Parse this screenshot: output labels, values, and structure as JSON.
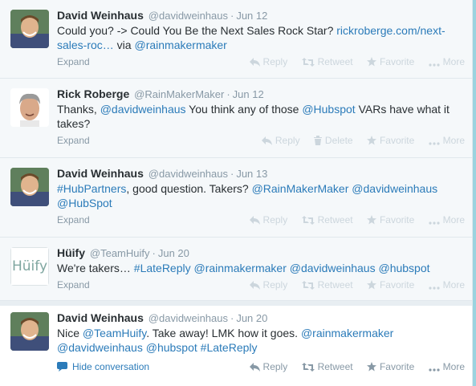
{
  "actions": {
    "reply": "Reply",
    "retweet": "Retweet",
    "delete": "Delete",
    "favorite": "Favorite",
    "more": "More",
    "expand": "Expand",
    "hide_conversation": "Hide conversation"
  },
  "colors": {
    "link": "#2b7bb9",
    "muted": "#8899a6",
    "action_disabled": "#ccd6dd",
    "background_collapsed": "#f5f8fa"
  },
  "tweets": [
    {
      "fullname": "David Weinhaus",
      "username": "@davidweinhaus",
      "time": "Jun 12",
      "text_parts": [
        "Could you? -> Could You Be the Next Sales Rock Star? ",
        "rickroberge.com/next-sales-roc…",
        " via ",
        "@rainmakermaker"
      ]
    },
    {
      "fullname": "Rick Roberge",
      "username": "@RainMakerMaker",
      "time": "Jun 12",
      "text_parts": [
        "Thanks, ",
        "@davidweinhaus",
        " You think any of those ",
        "@Hubspot",
        " VARs have what it takes?"
      ]
    },
    {
      "fullname": "David Weinhaus",
      "username": "@davidweinhaus",
      "time": "Jun 13",
      "text_parts": [
        "#HubPartners",
        ", good question. Takers? ",
        "@RainMakerMaker",
        " ",
        "@davidweinhaus",
        " ",
        "@HubSpot"
      ]
    },
    {
      "fullname": "Hüify",
      "username": "@TeamHuify",
      "time": "Jun 20",
      "avatar_text": "Hüify",
      "text_parts": [
        "We're takers… ",
        "#LateReply",
        " ",
        "@rainmakermaker",
        " ",
        "@davidweinhaus",
        " ",
        "@hubspot"
      ]
    },
    {
      "fullname": "David Weinhaus",
      "username": "@davidweinhaus",
      "time": "Jun 20",
      "text_parts": [
        "Nice ",
        "@TeamHuify",
        ". Take away! LMK how it goes. ",
        "@rainmakermaker",
        " ",
        "@davidweinhaus",
        " ",
        "@hubspot",
        " ",
        "#LateReply"
      ]
    }
  ]
}
